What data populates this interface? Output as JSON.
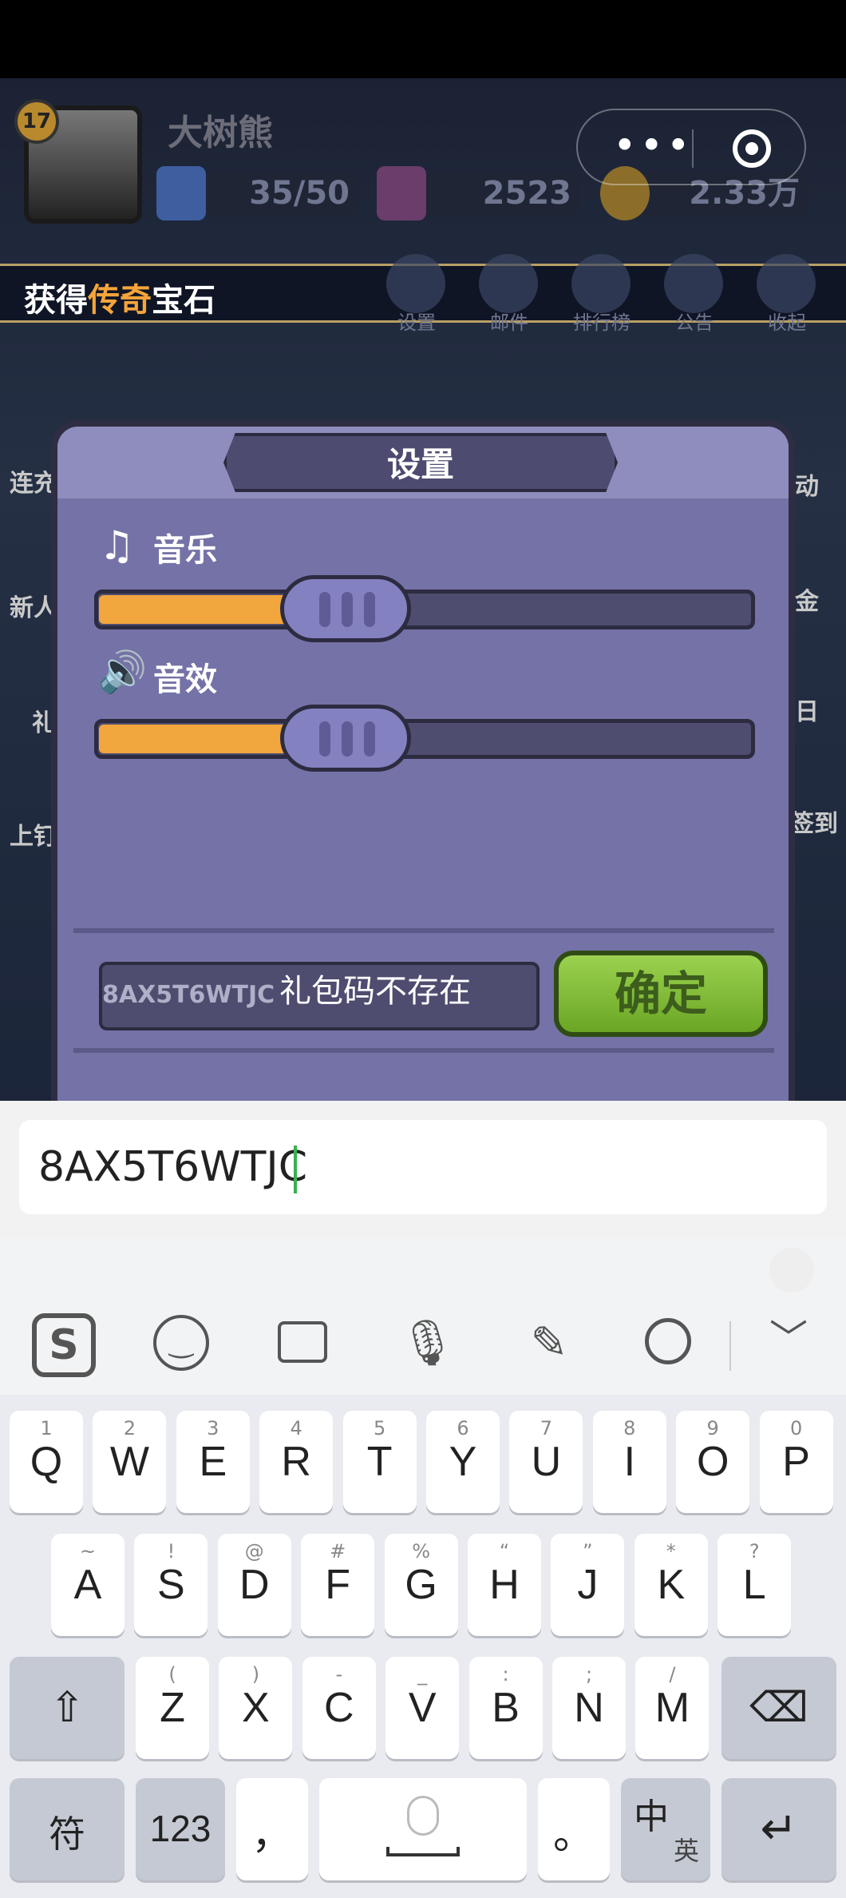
{
  "game": {
    "player": {
      "level": "17",
      "name": "大树熊"
    },
    "resources": {
      "energy": "35/50",
      "gems": "2523",
      "coins": "2.33万"
    },
    "marquee": {
      "prefix": "获得",
      "highlight": "传奇",
      "suffix": "宝石"
    },
    "top_buttons": [
      "设置",
      "邮件",
      "排行榜",
      "公告",
      "收起"
    ],
    "side_left": [
      "连充",
      "新人",
      "礼",
      "上钉"
    ],
    "side_right": [
      "动",
      "金",
      "日",
      "签到"
    ]
  },
  "dialog": {
    "title": "设置",
    "music_label": "音乐",
    "sfx_label": "音效",
    "music_level": 0.33,
    "sfx_level": 0.33,
    "code_value": "8AX5T6WTJC",
    "toast": "礼包码不存在",
    "confirm_label": "确定"
  },
  "input": {
    "value": "8AX5T6WTJC"
  },
  "keyboard": {
    "tools": [
      "sogou-logo",
      "emoji-icon",
      "keyboard-icon",
      "microphone-icon",
      "handwriting-icon",
      "search-icon",
      "collapse-icon"
    ],
    "row1": [
      {
        "k": "Q",
        "s": "1"
      },
      {
        "k": "W",
        "s": "2"
      },
      {
        "k": "E",
        "s": "3"
      },
      {
        "k": "R",
        "s": "4"
      },
      {
        "k": "T",
        "s": "5"
      },
      {
        "k": "Y",
        "s": "6"
      },
      {
        "k": "U",
        "s": "7"
      },
      {
        "k": "I",
        "s": "8"
      },
      {
        "k": "O",
        "s": "9"
      },
      {
        "k": "P",
        "s": "0"
      }
    ],
    "row2": [
      {
        "k": "A",
        "s": "~"
      },
      {
        "k": "S",
        "s": "!"
      },
      {
        "k": "D",
        "s": "@"
      },
      {
        "k": "F",
        "s": "#"
      },
      {
        "k": "G",
        "s": "%"
      },
      {
        "k": "H",
        "s": "“"
      },
      {
        "k": "J",
        "s": "”"
      },
      {
        "k": "K",
        "s": "*"
      },
      {
        "k": "L",
        "s": "?"
      }
    ],
    "row3": [
      {
        "k": "Z",
        "s": "("
      },
      {
        "k": "X",
        "s": ")"
      },
      {
        "k": "C",
        "s": "-"
      },
      {
        "k": "V",
        "s": "_"
      },
      {
        "k": "B",
        "s": ":"
      },
      {
        "k": "N",
        "s": ";"
      },
      {
        "k": "M",
        "s": "/"
      }
    ],
    "symbols_label": "符",
    "numbers_label": "123",
    "comma_label": "，",
    "period_label": "。",
    "lang_main": "中",
    "lang_sub": "英"
  }
}
